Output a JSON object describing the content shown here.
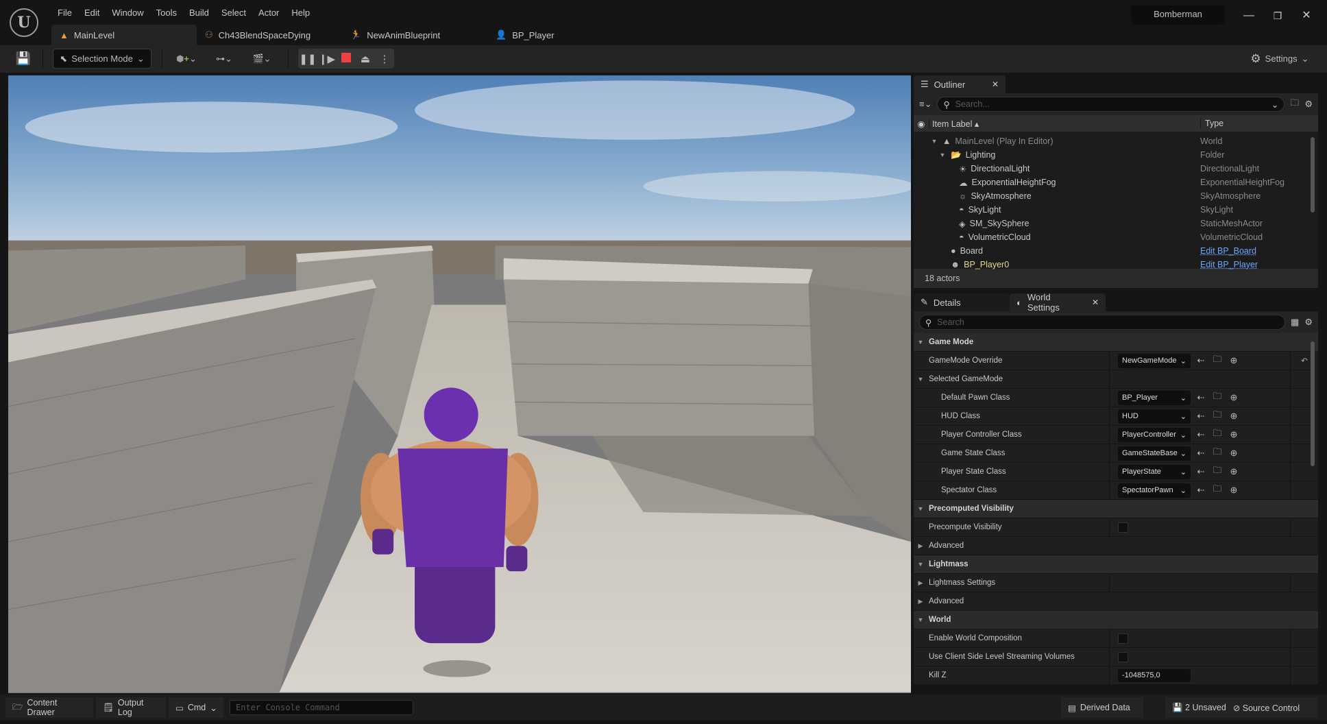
{
  "app": {
    "logo": "U",
    "project": "Bomberman",
    "minimize": "—",
    "restore": "❐",
    "close": "✕"
  },
  "menu": [
    "File",
    "Edit",
    "Window",
    "Tools",
    "Build",
    "Select",
    "Actor",
    "Help"
  ],
  "doc_tabs": [
    {
      "label": "MainLevel",
      "icon": "level-icon",
      "glyph": "▲",
      "color": "#e8a030"
    },
    {
      "label": "Ch43BlendSpaceDying",
      "icon": "blendspace-icon",
      "glyph": "⚇",
      "color": "#c08050"
    },
    {
      "label": "NewAnimBlueprint",
      "icon": "anim-blueprint-icon",
      "glyph": "🏃",
      "color": "#c08050"
    },
    {
      "label": "BP_Player",
      "icon": "blueprint-icon",
      "glyph": "👤",
      "color": "#3a6ad0"
    }
  ],
  "toolbar": {
    "selection_mode": "Selection Mode",
    "settings": "Settings",
    "stop_color": "#f04040"
  },
  "outliner": {
    "tab": "Outliner",
    "search_placeholder": "Search...",
    "col_label": "Item Label",
    "col_type": "Type",
    "footer": "18 actors",
    "rows": [
      {
        "label": "MainLevel (Play In Editor)",
        "type": "World",
        "depth": 0,
        "expander": "▼",
        "glyph": "▲",
        "dim": true
      },
      {
        "label": "Lighting",
        "type": "Folder",
        "depth": 1,
        "expander": "▼",
        "glyph": "📂"
      },
      {
        "label": "DirectionalLight",
        "type": "DirectionalLight",
        "depth": 2,
        "glyph": "☀"
      },
      {
        "label": "ExponentialHeightFog",
        "type": "ExponentialHeightFog",
        "depth": 2,
        "glyph": "☁"
      },
      {
        "label": "SkyAtmosphere",
        "type": "SkyAtmosphere",
        "depth": 2,
        "glyph": "☼"
      },
      {
        "label": "SkyLight",
        "type": "SkyLight",
        "depth": 2,
        "glyph": "◓"
      },
      {
        "label": "SM_SkySphere",
        "type": "StaticMeshActor",
        "depth": 2,
        "glyph": "◈"
      },
      {
        "label": "VolumetricCloud",
        "type": "VolumetricCloud",
        "depth": 2,
        "glyph": "◓"
      },
      {
        "label": "Board",
        "type": "Edit BP_Board",
        "depth": 1,
        "glyph": "●",
        "link": true
      },
      {
        "label": "BP_Player0",
        "type": "Edit BP_Player",
        "depth": 1,
        "glyph": "☻",
        "link": true,
        "highlight": "#e8d890"
      }
    ]
  },
  "details": {
    "tab_details": "Details",
    "tab_world": "World Settings",
    "search_placeholder": "Search",
    "rows": [
      {
        "kind": "cat",
        "label": "Game Mode"
      },
      {
        "kind": "combo",
        "label": "GameMode Override",
        "value": "NewGameMode",
        "reset": true,
        "indent": 0
      },
      {
        "kind": "sub",
        "label": "Selected GameMode"
      },
      {
        "kind": "combo",
        "label": "Default Pawn Class",
        "value": "BP_Player",
        "indent": 1
      },
      {
        "kind": "combo",
        "label": "HUD Class",
        "value": "HUD",
        "indent": 1
      },
      {
        "kind": "combo",
        "label": "Player Controller Class",
        "value": "PlayerController",
        "indent": 1
      },
      {
        "kind": "combo",
        "label": "Game State Class",
        "value": "GameStateBase",
        "indent": 1
      },
      {
        "kind": "combo",
        "label": "Player State Class",
        "value": "PlayerState",
        "indent": 1
      },
      {
        "kind": "combo",
        "label": "Spectator Class",
        "value": "SpectatorPawn",
        "indent": 1
      },
      {
        "kind": "cat",
        "label": "Precomputed Visibility"
      },
      {
        "kind": "check",
        "label": "Precompute Visibility",
        "checked": false
      },
      {
        "kind": "collapsed",
        "label": "Advanced"
      },
      {
        "kind": "cat",
        "label": "Lightmass"
      },
      {
        "kind": "collapsed",
        "label": "Lightmass Settings",
        "split": true
      },
      {
        "kind": "collapsed",
        "label": "Advanced"
      },
      {
        "kind": "cat",
        "label": "World"
      },
      {
        "kind": "check",
        "label": "Enable World Composition",
        "checked": false
      },
      {
        "kind": "check",
        "label": "Use Client Side Level Streaming Volumes",
        "checked": false
      },
      {
        "kind": "number",
        "label": "Kill Z",
        "value": "-1048575,0"
      }
    ]
  },
  "statusbar": {
    "content_drawer": "Content Drawer",
    "output_log": "Output Log",
    "cmd": "Cmd",
    "console_placeholder": "Enter Console Command",
    "derived_data": "Derived Data",
    "unsaved": "2 Unsaved",
    "source_control": "Source Control"
  }
}
